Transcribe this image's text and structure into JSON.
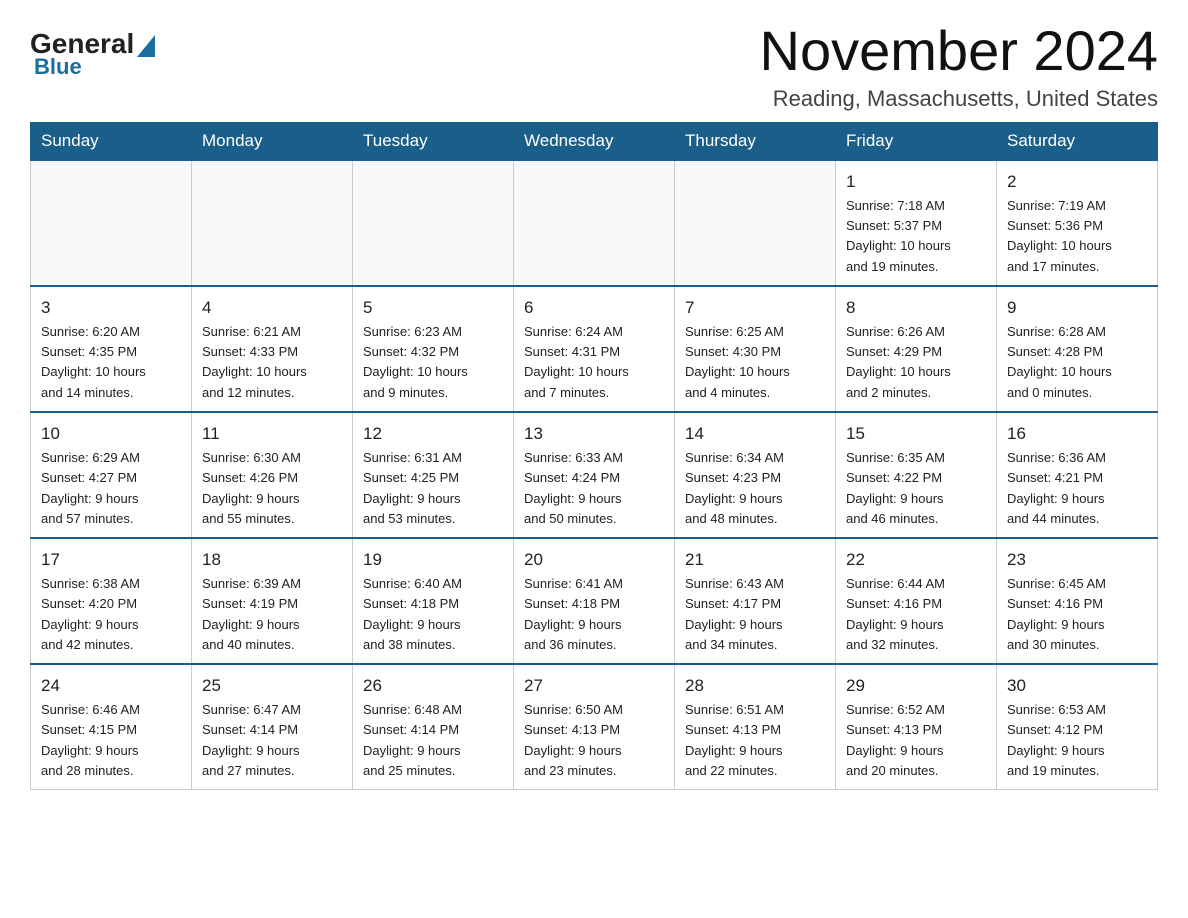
{
  "logo": {
    "general": "General",
    "blue": "Blue",
    "triangle_char": "▶"
  },
  "title": {
    "month_year": "November 2024",
    "location": "Reading, Massachusetts, United States"
  },
  "weekdays": [
    "Sunday",
    "Monday",
    "Tuesday",
    "Wednesday",
    "Thursday",
    "Friday",
    "Saturday"
  ],
  "weeks": [
    [
      {
        "day": "",
        "info": ""
      },
      {
        "day": "",
        "info": ""
      },
      {
        "day": "",
        "info": ""
      },
      {
        "day": "",
        "info": ""
      },
      {
        "day": "",
        "info": ""
      },
      {
        "day": "1",
        "info": "Sunrise: 7:18 AM\nSunset: 5:37 PM\nDaylight: 10 hours\nand 19 minutes."
      },
      {
        "day": "2",
        "info": "Sunrise: 7:19 AM\nSunset: 5:36 PM\nDaylight: 10 hours\nand 17 minutes."
      }
    ],
    [
      {
        "day": "3",
        "info": "Sunrise: 6:20 AM\nSunset: 4:35 PM\nDaylight: 10 hours\nand 14 minutes."
      },
      {
        "day": "4",
        "info": "Sunrise: 6:21 AM\nSunset: 4:33 PM\nDaylight: 10 hours\nand 12 minutes."
      },
      {
        "day": "5",
        "info": "Sunrise: 6:23 AM\nSunset: 4:32 PM\nDaylight: 10 hours\nand 9 minutes."
      },
      {
        "day": "6",
        "info": "Sunrise: 6:24 AM\nSunset: 4:31 PM\nDaylight: 10 hours\nand 7 minutes."
      },
      {
        "day": "7",
        "info": "Sunrise: 6:25 AM\nSunset: 4:30 PM\nDaylight: 10 hours\nand 4 minutes."
      },
      {
        "day": "8",
        "info": "Sunrise: 6:26 AM\nSunset: 4:29 PM\nDaylight: 10 hours\nand 2 minutes."
      },
      {
        "day": "9",
        "info": "Sunrise: 6:28 AM\nSunset: 4:28 PM\nDaylight: 10 hours\nand 0 minutes."
      }
    ],
    [
      {
        "day": "10",
        "info": "Sunrise: 6:29 AM\nSunset: 4:27 PM\nDaylight: 9 hours\nand 57 minutes."
      },
      {
        "day": "11",
        "info": "Sunrise: 6:30 AM\nSunset: 4:26 PM\nDaylight: 9 hours\nand 55 minutes."
      },
      {
        "day": "12",
        "info": "Sunrise: 6:31 AM\nSunset: 4:25 PM\nDaylight: 9 hours\nand 53 minutes."
      },
      {
        "day": "13",
        "info": "Sunrise: 6:33 AM\nSunset: 4:24 PM\nDaylight: 9 hours\nand 50 minutes."
      },
      {
        "day": "14",
        "info": "Sunrise: 6:34 AM\nSunset: 4:23 PM\nDaylight: 9 hours\nand 48 minutes."
      },
      {
        "day": "15",
        "info": "Sunrise: 6:35 AM\nSunset: 4:22 PM\nDaylight: 9 hours\nand 46 minutes."
      },
      {
        "day": "16",
        "info": "Sunrise: 6:36 AM\nSunset: 4:21 PM\nDaylight: 9 hours\nand 44 minutes."
      }
    ],
    [
      {
        "day": "17",
        "info": "Sunrise: 6:38 AM\nSunset: 4:20 PM\nDaylight: 9 hours\nand 42 minutes."
      },
      {
        "day": "18",
        "info": "Sunrise: 6:39 AM\nSunset: 4:19 PM\nDaylight: 9 hours\nand 40 minutes."
      },
      {
        "day": "19",
        "info": "Sunrise: 6:40 AM\nSunset: 4:18 PM\nDaylight: 9 hours\nand 38 minutes."
      },
      {
        "day": "20",
        "info": "Sunrise: 6:41 AM\nSunset: 4:18 PM\nDaylight: 9 hours\nand 36 minutes."
      },
      {
        "day": "21",
        "info": "Sunrise: 6:43 AM\nSunset: 4:17 PM\nDaylight: 9 hours\nand 34 minutes."
      },
      {
        "day": "22",
        "info": "Sunrise: 6:44 AM\nSunset: 4:16 PM\nDaylight: 9 hours\nand 32 minutes."
      },
      {
        "day": "23",
        "info": "Sunrise: 6:45 AM\nSunset: 4:16 PM\nDaylight: 9 hours\nand 30 minutes."
      }
    ],
    [
      {
        "day": "24",
        "info": "Sunrise: 6:46 AM\nSunset: 4:15 PM\nDaylight: 9 hours\nand 28 minutes."
      },
      {
        "day": "25",
        "info": "Sunrise: 6:47 AM\nSunset: 4:14 PM\nDaylight: 9 hours\nand 27 minutes."
      },
      {
        "day": "26",
        "info": "Sunrise: 6:48 AM\nSunset: 4:14 PM\nDaylight: 9 hours\nand 25 minutes."
      },
      {
        "day": "27",
        "info": "Sunrise: 6:50 AM\nSunset: 4:13 PM\nDaylight: 9 hours\nand 23 minutes."
      },
      {
        "day": "28",
        "info": "Sunrise: 6:51 AM\nSunset: 4:13 PM\nDaylight: 9 hours\nand 22 minutes."
      },
      {
        "day": "29",
        "info": "Sunrise: 6:52 AM\nSunset: 4:13 PM\nDaylight: 9 hours\nand 20 minutes."
      },
      {
        "day": "30",
        "info": "Sunrise: 6:53 AM\nSunset: 4:12 PM\nDaylight: 9 hours\nand 19 minutes."
      }
    ]
  ]
}
